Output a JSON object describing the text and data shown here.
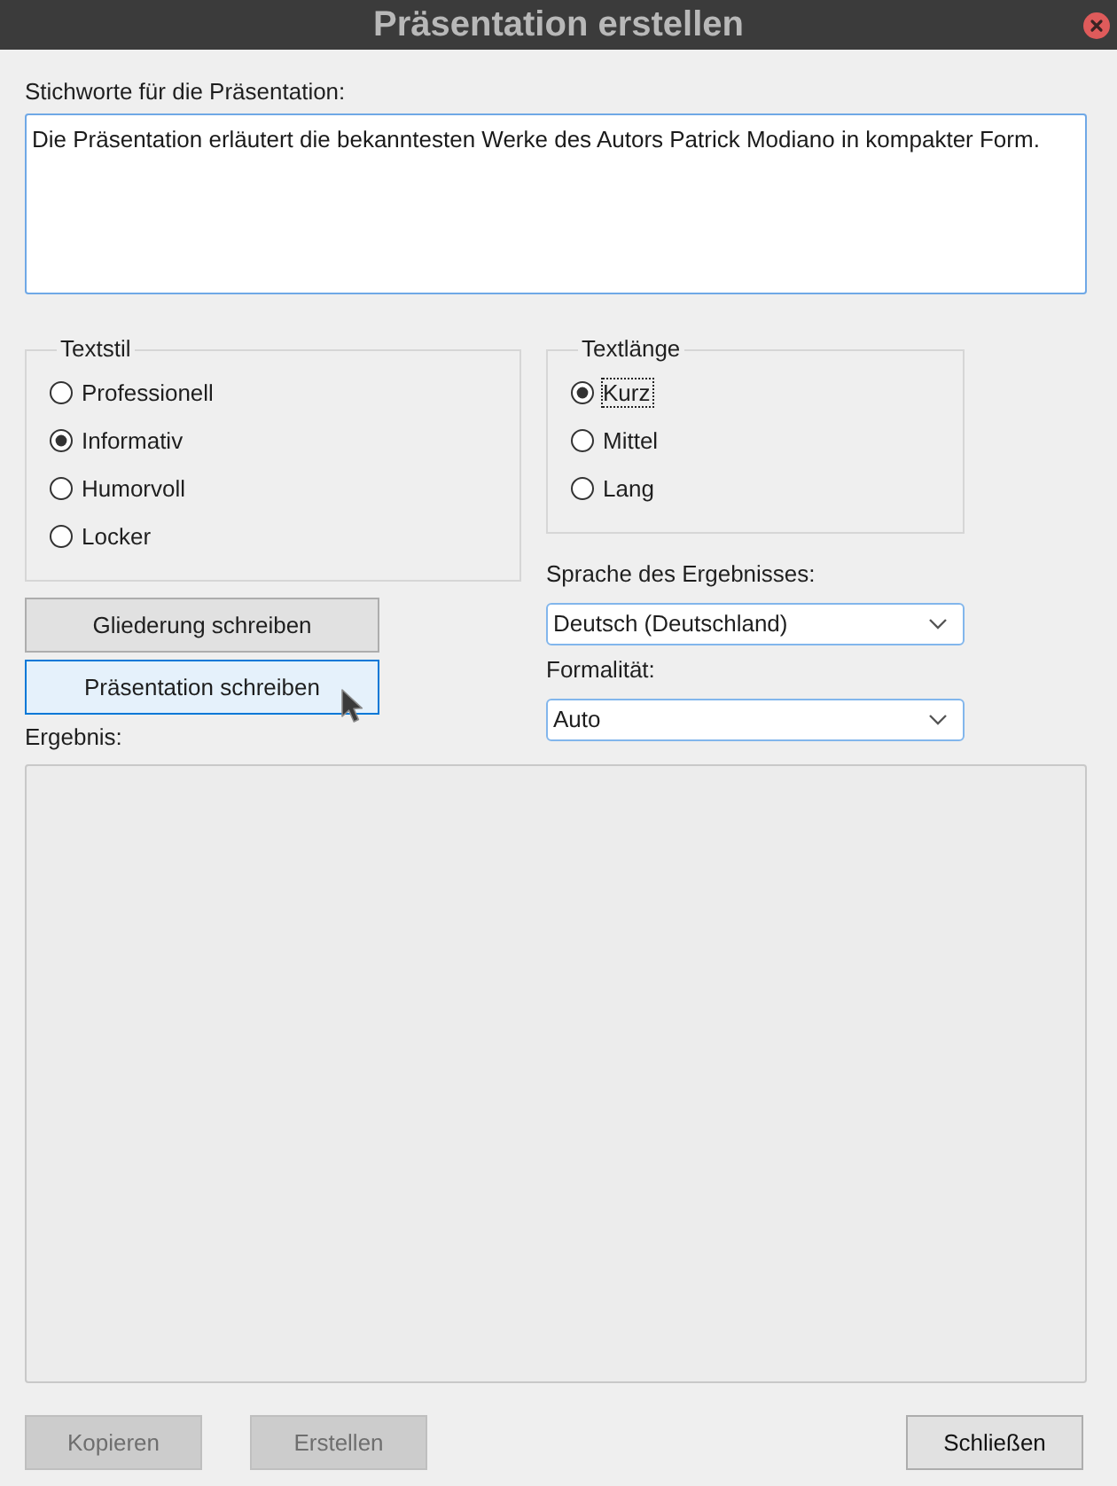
{
  "window": {
    "title": "Präsentation erstellen"
  },
  "keywords": {
    "label": "Stichworte für die Präsentation:",
    "value": "Die Präsentation erläutert die bekanntesten Werke des Autors Patrick Modiano in kompakter Form."
  },
  "text_style": {
    "title": "Textstil",
    "options": [
      {
        "label": "Professionell",
        "selected": false,
        "focused": false
      },
      {
        "label": "Informativ",
        "selected": true,
        "focused": false
      },
      {
        "label": "Humorvoll",
        "selected": false,
        "focused": false
      },
      {
        "label": "Locker",
        "selected": false,
        "focused": false
      }
    ]
  },
  "text_length": {
    "title": "Textlänge",
    "options": [
      {
        "label": "Kurz",
        "selected": true,
        "focused": true
      },
      {
        "label": "Mittel",
        "selected": false,
        "focused": false
      },
      {
        "label": "Lang",
        "selected": false,
        "focused": false
      }
    ]
  },
  "actions": [
    {
      "label": "Gliederung schreiben",
      "hovered": false
    },
    {
      "label": "Präsentation schreiben",
      "hovered": true
    }
  ],
  "language": {
    "label": "Sprache des Ergebnisses:",
    "value": "Deutsch (Deutschland)"
  },
  "formality": {
    "label": "Formalität:",
    "value": "Auto"
  },
  "result": {
    "label": "Ergebnis:"
  },
  "footer_buttons": [
    {
      "label": "Kopieren",
      "disabled": true
    },
    {
      "label": "Erstellen",
      "disabled": true
    },
    {
      "label": "Schließen",
      "disabled": false
    }
  ]
}
